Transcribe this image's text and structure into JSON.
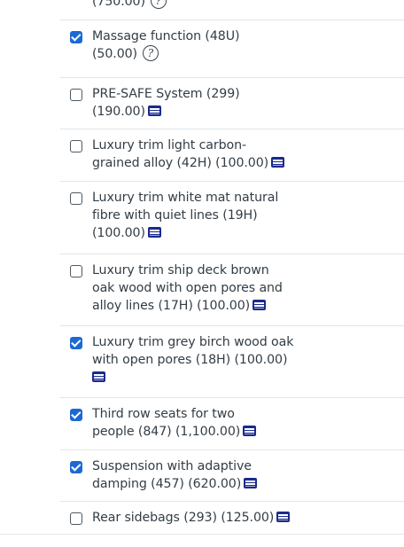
{
  "options": [
    {
      "label": "(750.00)",
      "checked": null,
      "icon": "info-icon"
    },
    {
      "label": "Massage function (48U) (50.00)",
      "checked": true,
      "icon": "info-icon"
    },
    {
      "label": "PRE-SAFE System (299) (190.00)",
      "checked": false,
      "icon": "list-icon"
    },
    {
      "label": "Luxury trim light carbon-grained alloy (42H) (100.00)",
      "checked": false,
      "icon": "list-icon"
    },
    {
      "label": "Luxury trim white mat natural fibre with quiet lines (19H) (100.00)",
      "checked": false,
      "icon": "list-icon"
    },
    {
      "label": "Luxury trim ship deck brown oak wood with open pores and alloy lines (17H) (100.00)",
      "checked": false,
      "icon": "list-icon"
    },
    {
      "label": "Luxury trim grey birch wood oak with open pores (18H) (100.00)",
      "checked": true,
      "icon": "list-icon"
    },
    {
      "label": "Third row seats for two people (847) (1,100.00)",
      "checked": true,
      "icon": "list-icon"
    },
    {
      "label": "Suspension with adaptive damping (457) (620.00)",
      "checked": true,
      "icon": "list-icon"
    },
    {
      "label": "Rear sidebags (293) (125.00)",
      "checked": false,
      "icon": "list-icon"
    }
  ],
  "lines": {
    "o0": [
      "(750.00)"
    ],
    "o1": [
      "Massage function (48U)",
      "(50.00)"
    ],
    "o2": [
      "PRE-SAFE System (299)",
      "(190.00)"
    ],
    "o3": [
      "Luxury trim light carbon-",
      "grained alloy (42H) (100.00)"
    ],
    "o4": [
      "Luxury trim white mat natural",
      "fibre with quiet lines (19H)",
      "(100.00)"
    ],
    "o5": [
      "Luxury trim ship deck brown",
      "oak wood with open pores and",
      "alloy lines (17H) (100.00)"
    ],
    "o6": [
      "Luxury trim grey birch wood oak",
      "with open pores (18H) (100.00)"
    ],
    "o7": [
      "Third row seats for two",
      "people (847) (1,100.00)"
    ],
    "o8": [
      "Suspension with adaptive",
      "damping (457) (620.00)"
    ],
    "o9": [
      "Rear sidebags (293) (125.00)"
    ]
  },
  "colors": {
    "checked": "#1c69d4",
    "text": "#333d45",
    "divider": "#e2e5e8",
    "list_icon": "#1a2a8c"
  }
}
